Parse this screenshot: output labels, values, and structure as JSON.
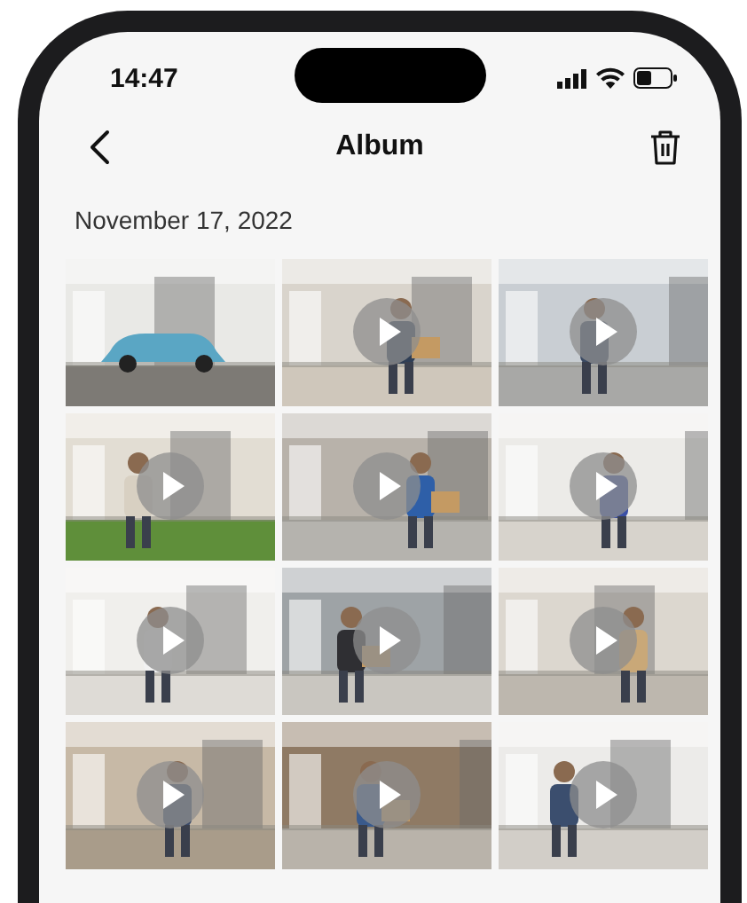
{
  "status_bar": {
    "time": "14:47"
  },
  "header": {
    "title": "Album"
  },
  "date": "November 17, 2022",
  "thumbnails": [
    {
      "kind": "picture",
      "video": false
    },
    {
      "kind": "picture",
      "video": true
    },
    {
      "kind": "picture",
      "video": true
    },
    {
      "kind": "picture",
      "video": true
    },
    {
      "kind": "picture",
      "video": true
    },
    {
      "kind": "picture",
      "video": true
    },
    {
      "kind": "picture",
      "video": true
    },
    {
      "kind": "picture",
      "video": true
    },
    {
      "kind": "picture",
      "video": true
    },
    {
      "kind": "picture",
      "video": true
    },
    {
      "kind": "picture",
      "video": true
    },
    {
      "kind": "picture",
      "video": true
    }
  ]
}
